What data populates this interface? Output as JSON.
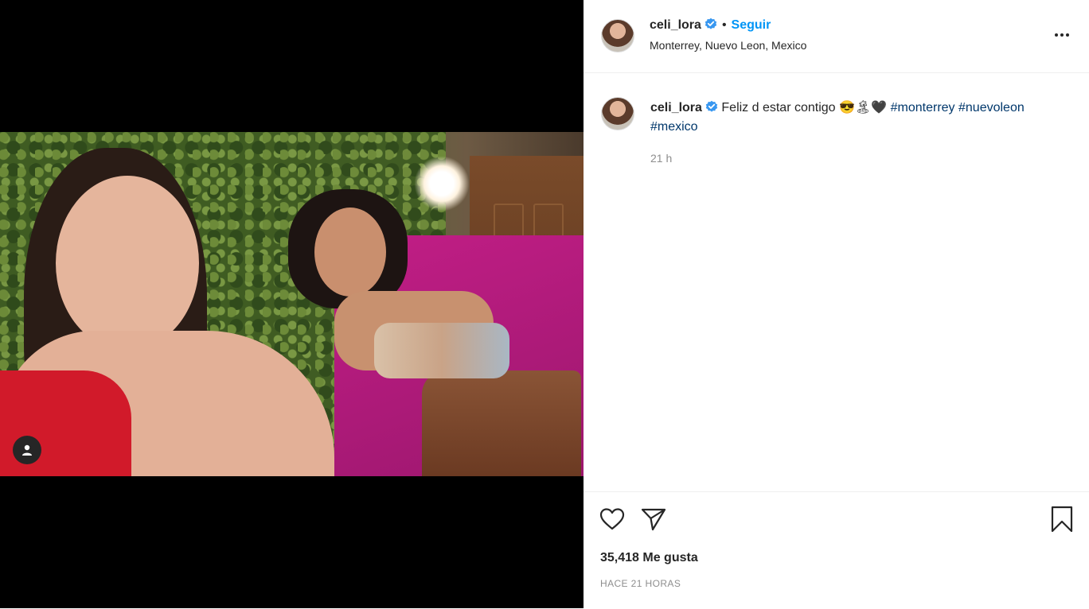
{
  "post": {
    "username": "celi_lora",
    "separator": "•",
    "follow_label": "Seguir",
    "location": "Monterrey, Nuevo Leon, Mexico",
    "more_label": "•••",
    "caption": {
      "username": "celi_lora",
      "text": "Feliz d estar contigo 😎🏝🖤",
      "hashtags": [
        "#monterrey",
        "#nuevoleon",
        "#mexico"
      ],
      "time": "21 h"
    },
    "likes": "35,418 Me gusta",
    "posted": "HACE 21 HORAS"
  },
  "icons": {
    "verified": "verified-badge-icon",
    "like": "heart-icon",
    "share": "send-icon",
    "save": "bookmark-icon",
    "tag": "user-tag-icon",
    "more": "more-options-icon"
  },
  "colors": {
    "accent": "#0095f6",
    "hashtag": "#00376b",
    "verified": "#3897f0",
    "muted": "#8e8e8e"
  }
}
